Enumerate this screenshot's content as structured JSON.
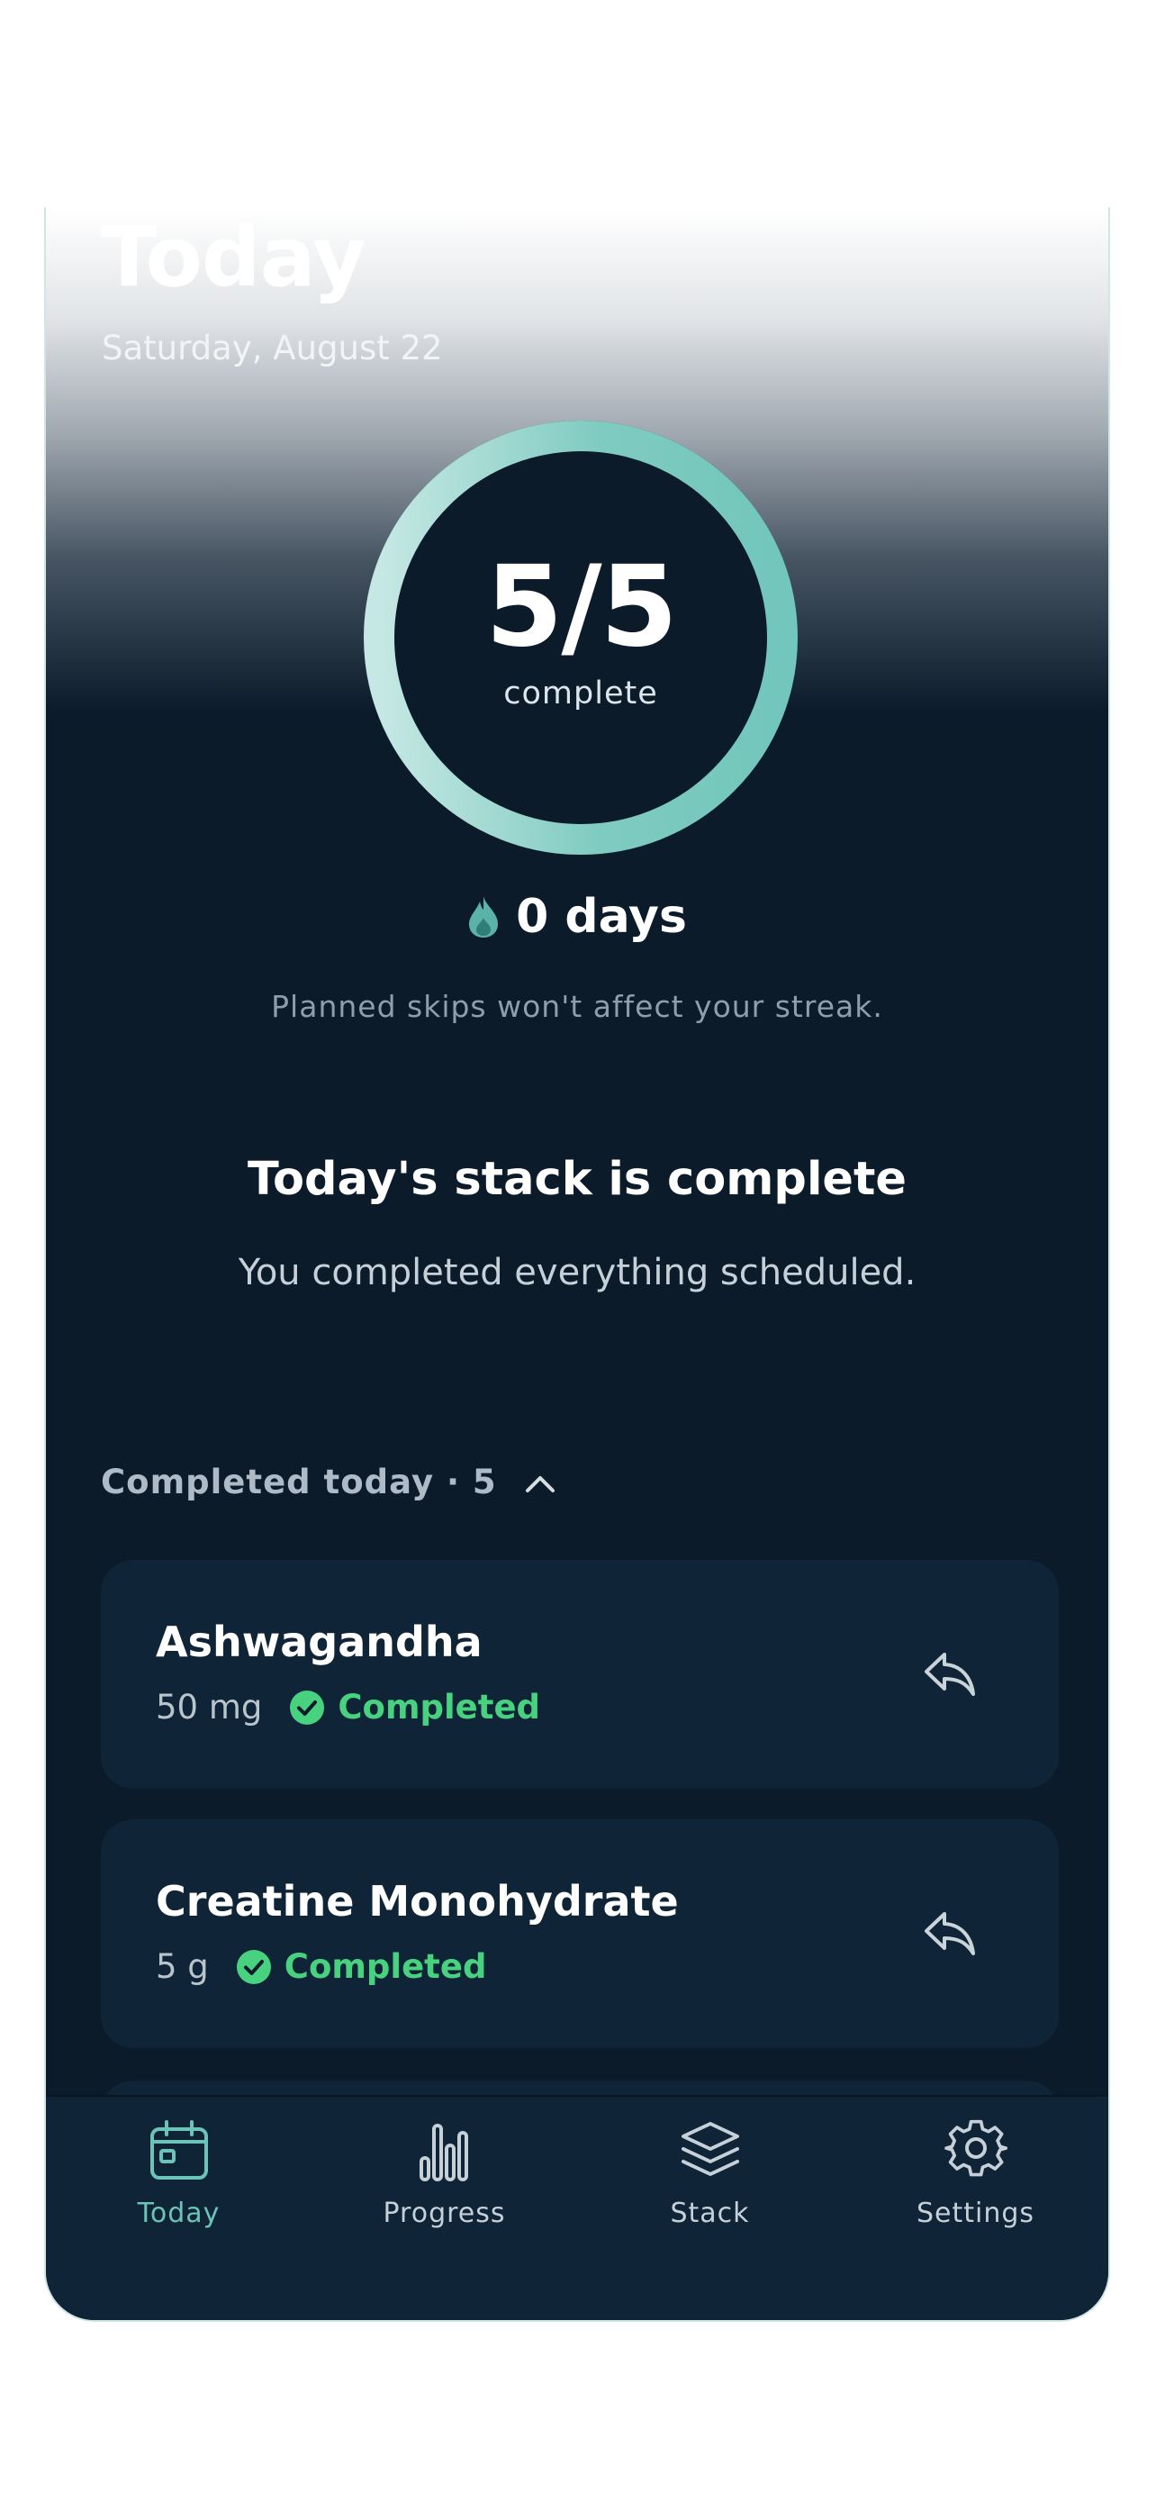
{
  "header": {
    "title": "Today",
    "date": "Saturday, August 22"
  },
  "progress": {
    "completed": 5,
    "total": 5,
    "label": "5/5",
    "caption": "complete"
  },
  "streak": {
    "icon": "flame-icon",
    "value": "0 days",
    "note": "Planned skips won't affect your streak."
  },
  "summary": {
    "title": "Today's stack is complete",
    "subtitle": "You completed everything scheduled."
  },
  "completed_section": {
    "label": "Completed today · 5",
    "expanded": true,
    "items": [
      {
        "name": "Ashwagandha",
        "dose": "50 mg",
        "status": "Completed"
      },
      {
        "name": "Creatine Monohydrate",
        "dose": "5 g",
        "status": "Completed"
      }
    ]
  },
  "tabs": [
    {
      "label": "Today",
      "icon": "calendar-icon",
      "active": true
    },
    {
      "label": "Progress",
      "icon": "bar-chart-icon",
      "active": false
    },
    {
      "label": "Stack",
      "icon": "layers-icon",
      "active": false
    },
    {
      "label": "Settings",
      "icon": "gear-icon",
      "active": false
    }
  ],
  "colors": {
    "background": "#0b1b2a",
    "card": "#102437",
    "accent": "#6cc3b8",
    "success": "#48d27f"
  }
}
